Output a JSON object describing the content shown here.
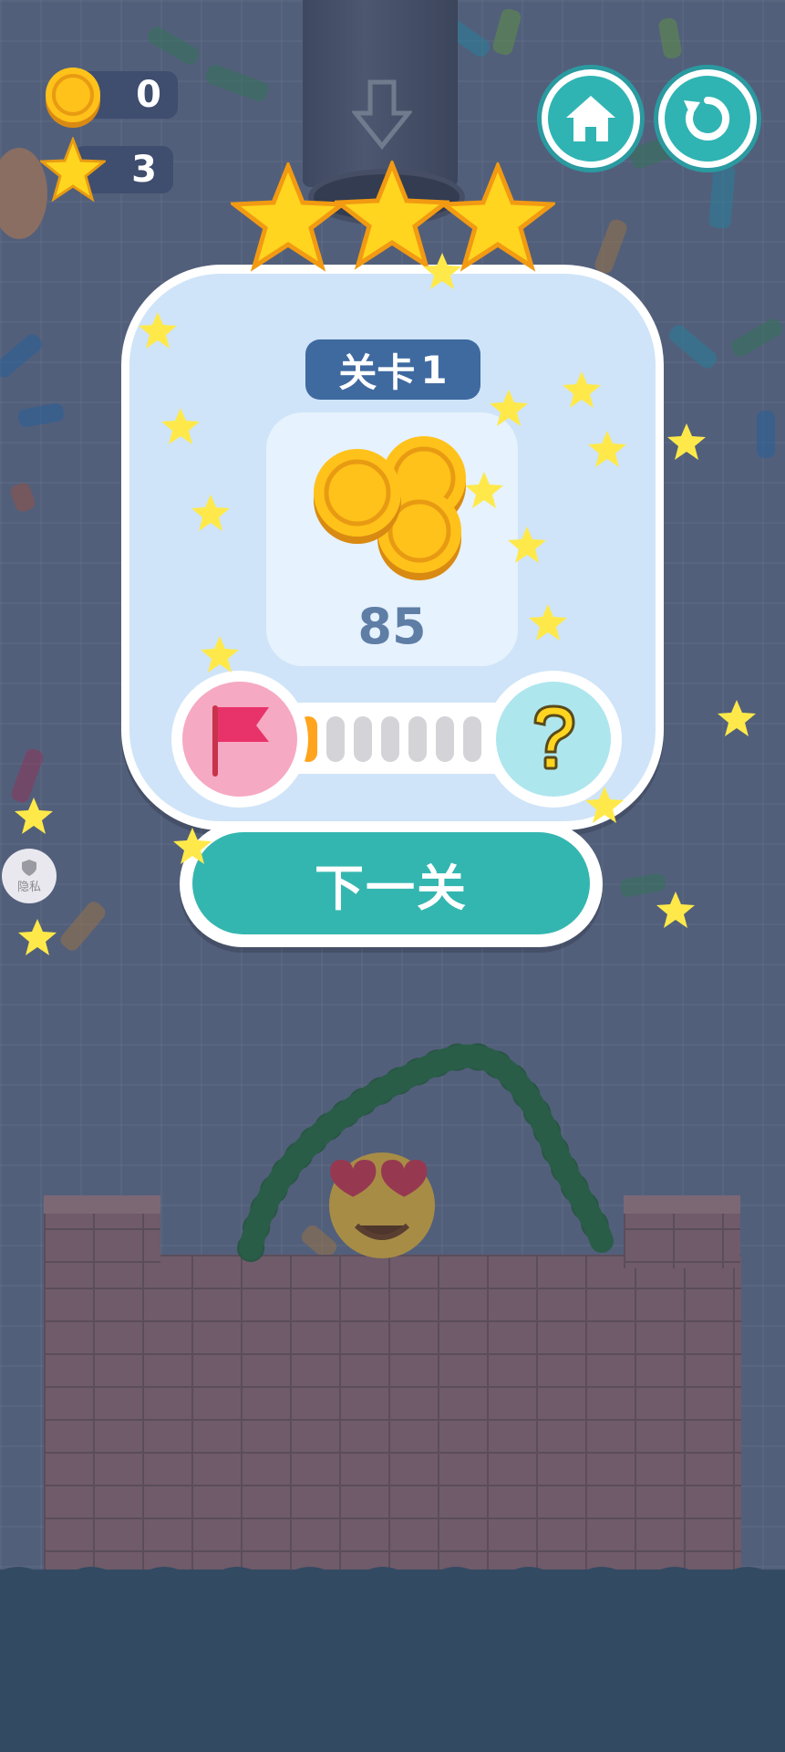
{
  "hud": {
    "coins": "0",
    "stars": "3"
  },
  "buttons": {
    "home_icon": "home-icon",
    "restart_icon": "restart-icon",
    "privacy_label": "隐私"
  },
  "result": {
    "stars_earned": 3,
    "stars_total": 3,
    "level_label": "关卡",
    "level_number": "1",
    "reward_amount": "85",
    "progress_segments_total": 7,
    "progress_segments_filled": 1,
    "next_button_label": "下一关"
  },
  "colors": {
    "accent_teal": "#34b6b0",
    "badge_blue": "#3f6aa0",
    "star_yellow": "#ffd51f",
    "progress_orange": "#ffa41c",
    "flag_pink": "#f6a9c2",
    "mystery_cyan": "#aee6ee"
  }
}
